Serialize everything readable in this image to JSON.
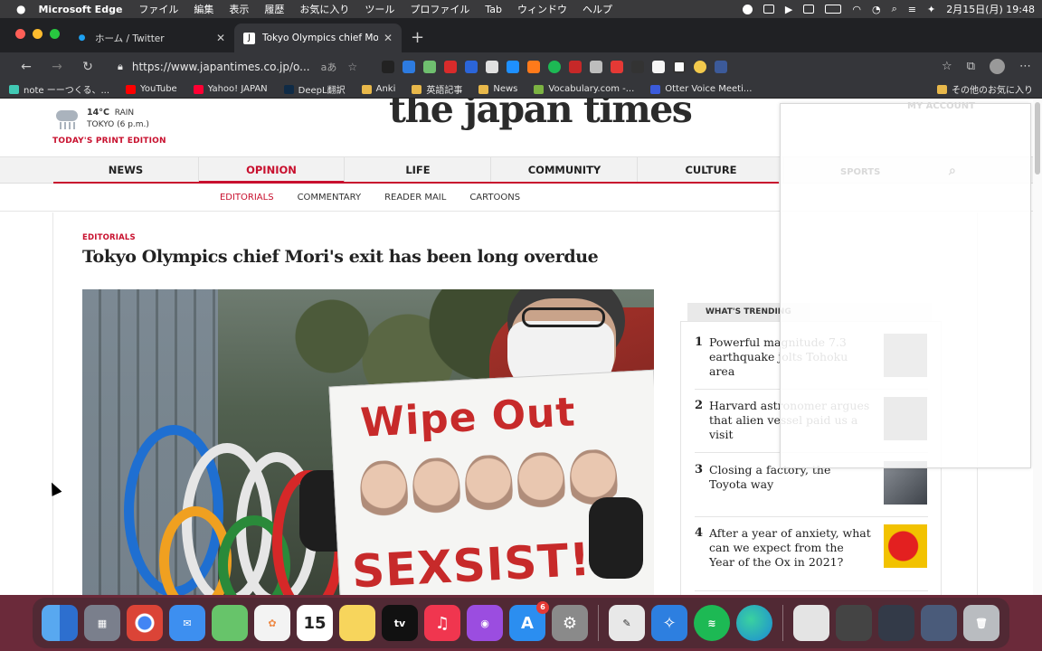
{
  "menubar": {
    "app_name": "Microsoft Edge",
    "items": [
      "ファイル",
      "編集",
      "表示",
      "履歴",
      "お気に入り",
      "ツール",
      "プロファイル",
      "Tab",
      "ウィンドウ",
      "ヘルプ"
    ],
    "datetime": "2月15日(月)  19:48"
  },
  "browser": {
    "tabs": [
      {
        "title": "ホーム / Twitter",
        "icon": "twitter-icon"
      },
      {
        "title": "Tokyo Olympics chief Mori's exit",
        "icon": "japan-times-icon"
      }
    ],
    "new_tab_label": "+",
    "url": "https://www.japantimes.co.jp/o...",
    "read_aloud_label": "aあ",
    "bookmarks": [
      {
        "label": "note ーーつくる、...",
        "color": "#41c9b4"
      },
      {
        "label": "YouTube",
        "color": "#ff0000"
      },
      {
        "label": "Yahoo! JAPAN",
        "color": "#ff0033"
      },
      {
        "label": "DeepL翻訳",
        "color": "#0f2b46"
      },
      {
        "label": "Anki",
        "color": "#e8b84a"
      },
      {
        "label": "英語記事",
        "color": "#e8b84a"
      },
      {
        "label": "News",
        "color": "#e8b84a"
      },
      {
        "label": "Vocabulary.com -...",
        "color": "#7cb342"
      },
      {
        "label": "Otter Voice Meeti...",
        "color": "#3b5bdb"
      }
    ],
    "other_bookmarks": "その他のお気に入り"
  },
  "site": {
    "logo": "the japan times",
    "weather": {
      "temp": "14°C",
      "condition": "RAIN",
      "location": "TOKYO (6 p.m.)"
    },
    "print_edition": "TODAY'S PRINT EDITION",
    "nav": [
      "NEWS",
      "OPINION",
      "LIFE",
      "COMMUNITY",
      "CULTURE"
    ],
    "subnav": [
      "EDITORIALS",
      "COMMENTARY",
      "READER MAIL",
      "CARTOONS"
    ],
    "article": {
      "kicker": "EDITORIALS",
      "headline": "Tokyo Olympics chief Mori's exit has been long overdue",
      "photo": {
        "sign_line1": "Wipe Out",
        "sign_line2": "SEXSIST!"
      }
    },
    "trending": {
      "tab_active": "WHAT'S TRENDING",
      "items": [
        {
          "num": "1",
          "text": "Powerful magnitude 7.3 earthquake jolts Tohoku area"
        },
        {
          "num": "2",
          "text": "Harvard astronomer argues that alien vessel paid us a visit"
        },
        {
          "num": "3",
          "text": "Closing a factory, the Toyota way"
        },
        {
          "num": "4",
          "text": "After a year of anxiety, what can we expect from the Year of the Ox in 2021?"
        }
      ]
    },
    "overlay_ghosts": {
      "account": "MY ACCOUNT",
      "sports": "SPORTS"
    }
  },
  "dock": {
    "apps": [
      {
        "name": "finder",
        "color": "#3f8fe8"
      },
      {
        "name": "launchpad",
        "color": "#7a7f8c"
      },
      {
        "name": "chrome",
        "color": "#e9e9e9"
      },
      {
        "name": "mail",
        "color": "#3d8ff0"
      },
      {
        "name": "maps",
        "color": "#67c46a"
      },
      {
        "name": "photos",
        "color": "#f3f3f3"
      },
      {
        "name": "calendar",
        "color": "#ffffff",
        "label": "15"
      },
      {
        "name": "notes",
        "color": "#f7d55c"
      },
      {
        "name": "tv",
        "color": "#111111",
        "label": "tv"
      },
      {
        "name": "music",
        "color": "#f0364f"
      },
      {
        "name": "podcasts",
        "color": "#9b4de0"
      },
      {
        "name": "app-store",
        "color": "#2b8ef0",
        "badge": "6"
      },
      {
        "name": "system-preferences",
        "color": "#8a8a8a"
      },
      {
        "name": "textedit",
        "color": "#e8e8e8"
      },
      {
        "name": "safari",
        "color": "#2d7fe0"
      },
      {
        "name": "spotify",
        "color": "#1db954"
      },
      {
        "name": "edge",
        "color": "#1c8ad6"
      },
      {
        "name": "preview",
        "color": "#e4e4e4"
      },
      {
        "name": "downloads",
        "color": "#444444"
      },
      {
        "name": "recent-window",
        "color": "#333a48"
      },
      {
        "name": "recent-window-2",
        "color": "#4a5b7a"
      },
      {
        "name": "trash",
        "color": "#b9bcc0"
      }
    ]
  }
}
